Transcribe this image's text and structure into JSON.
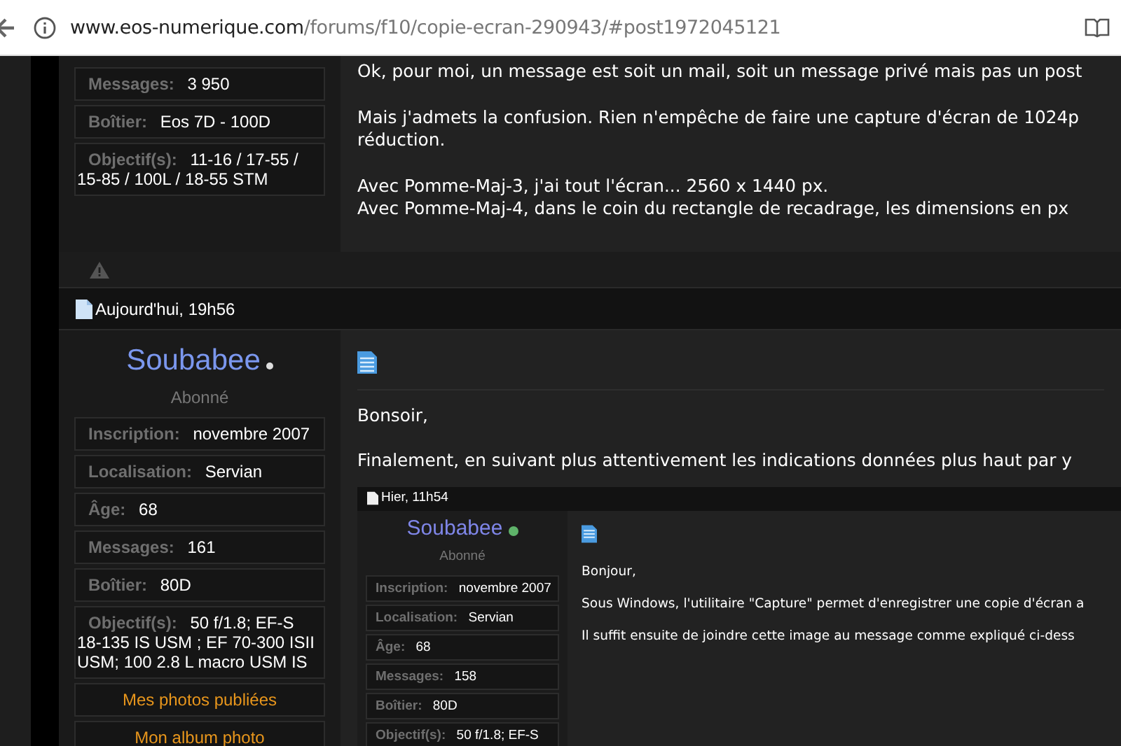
{
  "address_bar": {
    "host": "www.eos-numerique.com",
    "path": "/forums/f10/copie-ecran-290943/#post1972045121"
  },
  "previous_post": {
    "stats": [
      {
        "label": "Messages:",
        "value": "3 950"
      },
      {
        "label": "Boîtier:",
        "value": "Eos 7D - 100D"
      },
      {
        "label": "Objectif(s):",
        "value": "11-16 / 17-55 / 15-85 / 100L / 18-55 STM"
      }
    ],
    "paragraphs": [
      [
        "Ok, pour moi, un message est soit un mail, soit un message privé mais pas un post"
      ],
      [
        "Mais j'admets la confusion. Rien n'empêche de faire une capture d'écran de 1024p",
        "réduction."
      ],
      [
        "Avec Pomme-Maj-3, j'ai tout l'écran... 2560 x 1440 px.",
        "Avec Pomme-Maj-4, dans le coin du rectangle de recadrage, les dimensions en px"
      ]
    ]
  },
  "post": {
    "date": "Aujourd'hui, 19h56",
    "username": "Soubabee",
    "online": false,
    "rank": "Abonné",
    "stats": [
      {
        "label": "Inscription:",
        "value": "novembre 2007"
      },
      {
        "label": "Localisation:",
        "value": "Servian"
      },
      {
        "label": "Âge:",
        "value": "68"
      },
      {
        "label": "Messages:",
        "value": "161"
      },
      {
        "label": "Boîtier:",
        "value": "80D"
      },
      {
        "label": "Objectif(s):",
        "value": "50 f/1.8; EF-S 18-135 IS USM ; EF 70-300 ISII USM; 100 2.8 L macro USM IS"
      }
    ],
    "links": [
      "Mes photos publiées",
      "Mon album photo"
    ],
    "paragraphs": [
      [
        "Bonsoir,"
      ],
      [
        "Finalement, en suivant plus attentivement les indications données plus haut par y"
      ]
    ],
    "embedded_screenshot": {
      "date": "Hier, 11h54",
      "username": "Soubabee",
      "online": true,
      "rank": "Abonné",
      "stats": [
        {
          "label": "Inscription:",
          "value": "novembre 2007"
        },
        {
          "label": "Localisation:",
          "value": "Servian"
        },
        {
          "label": "Âge:",
          "value": "68"
        },
        {
          "label": "Messages:",
          "value": "158"
        },
        {
          "label": "Boîtier:",
          "value": "80D"
        },
        {
          "label": "Objectif(s):",
          "value": "50 f/1.8; EF-S"
        }
      ],
      "paragraphs": [
        [
          "Bonjour,"
        ],
        [
          "Sous Windows, l'utilitaire \"Capture\" permet d'enregistrer une copie d'écran a"
        ],
        [
          "Il suffit ensuite de joindre cette image au message comme expliqué ci-dess"
        ]
      ]
    }
  }
}
